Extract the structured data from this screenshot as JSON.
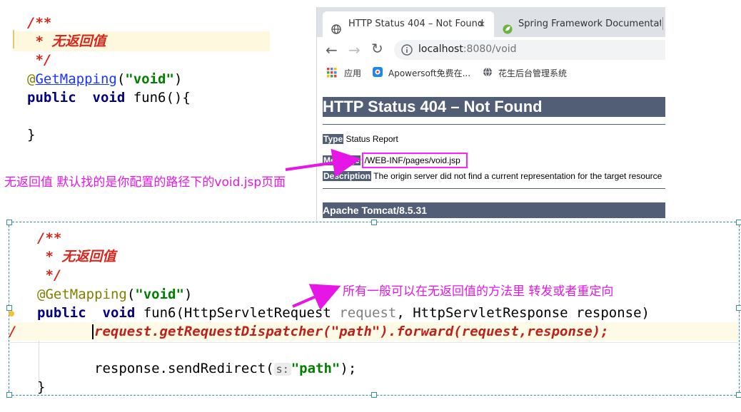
{
  "top_code": {
    "comment_open": "/**",
    "comment_text": " * 无返回值",
    "comment_close": " */",
    "annotation_at": "@",
    "annotation_name": "GetMapping",
    "annotation_paren_open": "(",
    "annotation_value": "\"void\"",
    "annotation_paren_close": ")",
    "decl_public": "public",
    "decl_void": "void",
    "decl_rest": " fun6(){",
    "close_brace": "}"
  },
  "browser": {
    "tabs": [
      {
        "label": "HTTP Status 404 – Not Found",
        "close": "✕"
      },
      {
        "label": "Spring Framework Documentati"
      }
    ],
    "address": {
      "host": "localhost",
      "rest": ":8080/void"
    },
    "bookmarks": [
      {
        "label": "应用"
      },
      {
        "label": "Apowersoft免费在..."
      },
      {
        "label": "花生后台管理系统"
      }
    ],
    "page": {
      "heading": "HTTP Status 404 – Not Found",
      "type_label": "Type",
      "type_value": " Status Report",
      "message_label": "Message",
      "message_value": "/WEB-INF/pages/void.jsp",
      "description_label": "Description",
      "description_value": " The origin server did not find a current representation for the target resource",
      "footer": "Apache Tomcat/8.5.31"
    }
  },
  "left_note": "无返回值 默认找的是你配置的路径下的void.jsp页面",
  "right_note": "所有一般可以在无返回值的方法里 转发或者重定向",
  "bottom_code": {
    "comment_open": "/**",
    "comment_text": " * 无返回值",
    "comment_close": " */",
    "annotation": "@GetMapping",
    "annotation_paren_open": "(",
    "annotation_value": "\"void\"",
    "annotation_paren_close": ")",
    "decl_public": "public",
    "decl_void": "void",
    "decl_name": " fun6(HttpServletRequest ",
    "decl_param1": "request",
    "decl_mid": ", HttpServletResponse response)",
    "gutter_slash": "/",
    "forward_line": "request.getRequestDispatcher(\"path\").forward(request,response);",
    "redirect_prefix": "response.sendRedirect(",
    "redirect_hint": "s:",
    "redirect_value": "\"path\"",
    "redirect_suffix": ");",
    "close_brace": "}"
  },
  "colors": {
    "note_magenta": "#e617e6",
    "tomcat_bar": "#525d76",
    "highlight_line": "#fdfbe6"
  }
}
